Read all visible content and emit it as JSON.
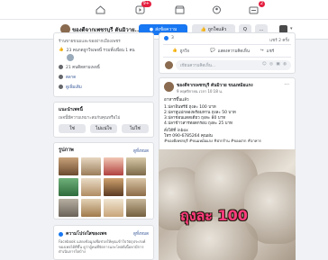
{
  "topnav": {
    "icons": [
      "home-icon",
      "watch-icon",
      "marketplace-icon",
      "groups-icon",
      "gaming-icon"
    ],
    "badges": {
      "watch": "9+",
      "gaming": "2"
    }
  },
  "header": {
    "page_name": "ของดีจากเพชรบุรี ตันมิวาย...",
    "send_message": "ส่งข้อความ",
    "like": "ถูกใจแล้ว",
    "search": "Q",
    "more": "..."
  },
  "intro": {
    "tagline": "ร้านขายขนมและของฝากเมืองเพชร",
    "likes": "23 คนกดถูกใจเพจนี้ รวมทั้งเพื่อน 1 คน",
    "follows": "21 คนติดตามเพจนี้",
    "category": "ตลาด",
    "see_more": "ดูเพิ่มเติม"
  },
  "suggest": {
    "title": "แนะนำเพจนี้",
    "question": "เพจนี้มีความเหมาะสมกับคุณหรือไม่",
    "yes": "ใช่",
    "not_sure": "ไม่แน่ใจ",
    "no": "ไม่ใช่"
  },
  "photos": {
    "title": "รูปภาพ",
    "see_all": "ดูทั้งหมด"
  },
  "transparency": {
    "title": "ความโปร่งใสของเพจ",
    "see_all": "ดูทั้งหมด",
    "body": "Facebook แสดงข้อมูลเพื่อช่วยให้คุณเข้าใจวัตถุประสงค์ของเพจได้ดีขึ้น ดูว่าผู้คนที่จัดการและโพสต์เนื้อหามีการดำเนินการใดบ้าง"
  },
  "post1": {
    "reactions": "3",
    "shares": "แชร์ 2 ครั้ง",
    "like": "ถูกใจ",
    "comment": "แสดงความคิดเห็น",
    "share": "แชร์",
    "comment_placeholder": "เขียนความคิดเห็น..."
  },
  "post2": {
    "author": "ของดีจากเพชรบุรี ตันมิวาย ขนมหม้อแกง",
    "time": "9 พฤศจิกายน เวลา 10:18 น.",
    "lines": [
      "อาหารขึ้นแล้ว",
      "1.ปลาอินทรีย์ ถุงละ 100 บาท",
      "2.ปลาทูแม่กลองพร้อมทาน ถุงละ 50 บาท",
      "3.ปลาช่อนแดดเดียว ถุงละ 80 บาท",
      "4.ปลาข้าวสารทอดกรอบ ถุงละ 25 บาท",
      "สั่งได้ที่ inbox",
      "โทร 090-6785264 คุณฝน"
    ],
    "hashtags": "#ของดีเพชรบุรี #ขนมหม้อแกง #ฝากร้าน #ของฝาก #อาหาร",
    "image_caption": "ถุงละ 100"
  }
}
